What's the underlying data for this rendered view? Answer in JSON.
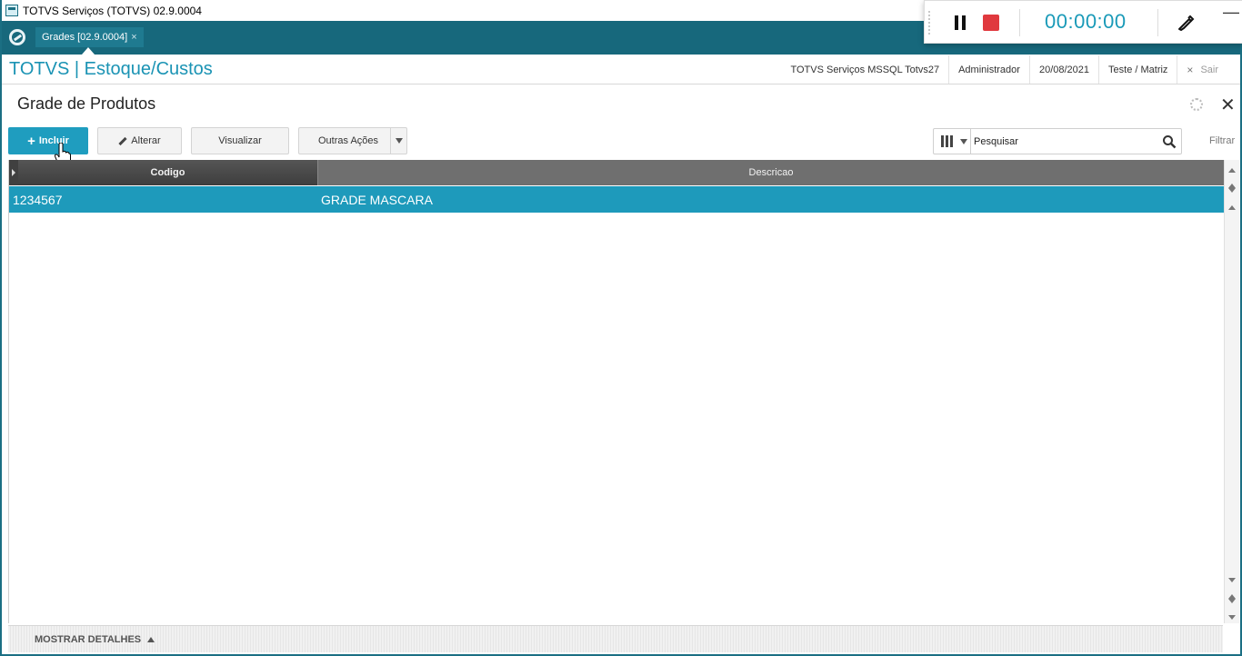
{
  "window": {
    "title": "TOTVS Serviços (TOTVS) 02.9.0004"
  },
  "tabs": [
    {
      "label": "Grades [02.9.0004]",
      "close": "×"
    }
  ],
  "recorder": {
    "timer": "00:00:00",
    "minimize": "—"
  },
  "header": {
    "module_title": "TOTVS | Estoque/Custos",
    "company": "TOTVS Serviços MSSQL Totvs27",
    "user": "Administrador",
    "date": "20/08/2021",
    "branch": "Teste / Matriz",
    "exit_label": "Sair",
    "exit_icon": "×"
  },
  "page": {
    "title": "Grade de Produtos",
    "close": "✕"
  },
  "toolbar": {
    "incluir_label": "Incluir",
    "alterar_label": "Alterar",
    "visualizar_label": "Visualizar",
    "outras_label": "Outras Ações"
  },
  "search": {
    "placeholder": "Pesquisar",
    "filter_label": "Filtrar"
  },
  "grid": {
    "columns": [
      "Codigo",
      "Descricao"
    ],
    "rows": [
      {
        "codigo": "1234567",
        "descricao": "GRADE MASCARA"
      }
    ]
  },
  "footer": {
    "details_label": "MOSTRAR DETALHES"
  },
  "colors": {
    "primary": "#1f9dbf",
    "tabbar": "#17687c",
    "selected_row": "#1e9abb",
    "stop": "#e0393e"
  }
}
